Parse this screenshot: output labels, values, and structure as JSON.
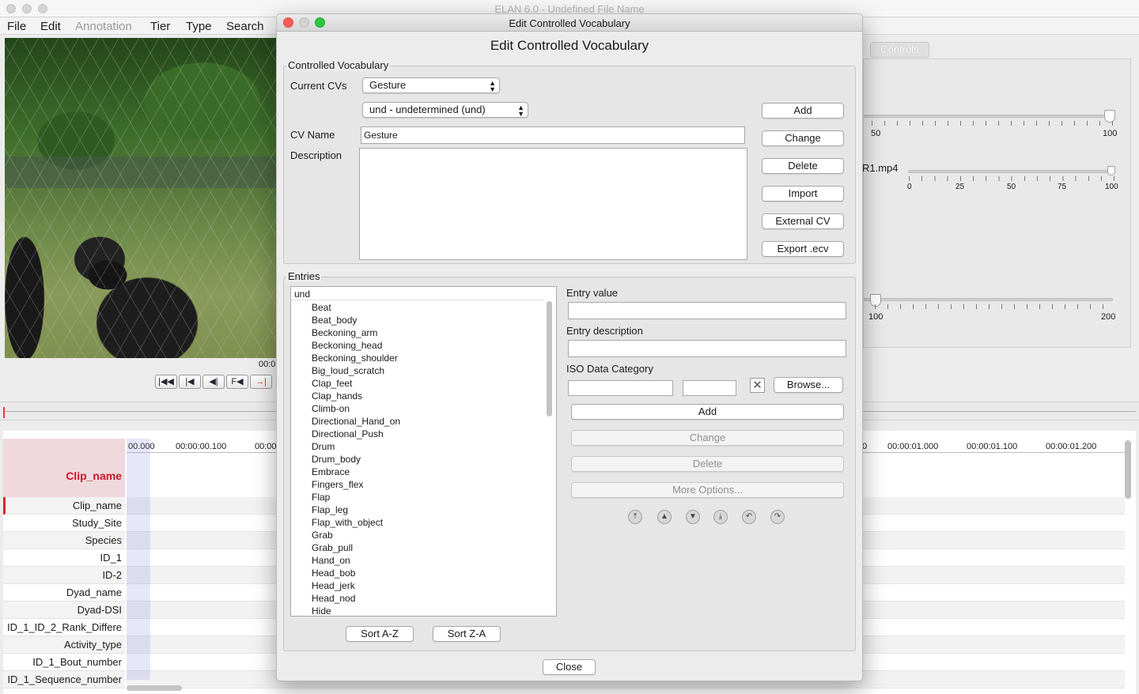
{
  "app": {
    "window_title": "ELAN 6.0 - Undefined File Name",
    "menu": [
      "File",
      "Edit",
      "Annotation",
      "Tier",
      "Type",
      "Search"
    ],
    "time_display": "00:0",
    "controls_tab": "Controls",
    "media_label": "R1.mp4"
  },
  "sliders": {
    "rate": {
      "labels": [
        "50",
        "100"
      ],
      "value": 100
    },
    "volume": {
      "labels": [
        "0",
        "25",
        "50",
        "75",
        "100"
      ],
      "value": 100
    },
    "zoom": {
      "labels": [
        "100",
        "200"
      ],
      "value": 100
    }
  },
  "player_buttons": [
    "|◀◀",
    "|◀",
    "◀|",
    "F◀",
    "→|"
  ],
  "timeline": {
    "ruler_labels_left": [
      "00.000",
      "00:00:00.100",
      "00:00"
    ],
    "ruler_labels_right": [
      "0",
      "00:00:01.000",
      "00:00:01.100",
      "00:00:01.200"
    ],
    "active_tier": "Clip_name",
    "tiers": [
      "Clip_name",
      "Study_Site",
      "Species",
      "ID_1",
      "ID-2",
      "Dyad_name",
      "Dyad-DSI",
      "ID_1_ID_2_Rank_Differe",
      "Activity_type",
      "ID_1_Bout_number",
      "ID_1_Sequence_number"
    ]
  },
  "dialog": {
    "window_title": "Edit Controlled Vocabulary",
    "heading": "Edit Controlled Vocabulary",
    "cv_group_label": "Controlled Vocabulary",
    "current_cvs_label": "Current CVs",
    "current_cv": "Gesture",
    "language": "und - undetermined (und)",
    "cv_name_label": "CV Name",
    "cv_name_value": "Gesture",
    "description_label": "Description",
    "description_value": "",
    "cv_buttons": [
      "Add",
      "Change",
      "Delete",
      "Import",
      "External CV",
      "Export .ecv"
    ],
    "entries_group_label": "Entries",
    "entries_root": "und",
    "entries": [
      "Beat",
      "Beat_body",
      "Beckoning_arm",
      "Beckoning_head",
      "Beckoning_shoulder",
      "Big_loud_scratch",
      "Clap_feet",
      "Clap_hands",
      "Climb-on",
      "Directional_Hand_on",
      "Directional_Push",
      "Drum",
      "Drum_body",
      "Embrace",
      "Fingers_flex",
      "Flap",
      "Flap_leg",
      "Flap_with_object",
      "Grab",
      "Grab_pull",
      "Hand_on",
      "Head_bob",
      "Head_jerk",
      "Head_nod",
      "Hide"
    ],
    "entry_value_label": "Entry value",
    "entry_value": "",
    "entry_description_label": "Entry description",
    "entry_description": "",
    "iso_label": "ISO Data Category",
    "iso_value_1": "",
    "iso_value_2": "",
    "browse_label": "Browse...",
    "entry_add_label": "Add",
    "entry_change_label": "Change",
    "entry_delete_label": "Delete",
    "more_options_label": "More Options...",
    "sort_az_label": "Sort A-Z",
    "sort_za_label": "Sort Z-A",
    "close_label": "Close"
  }
}
